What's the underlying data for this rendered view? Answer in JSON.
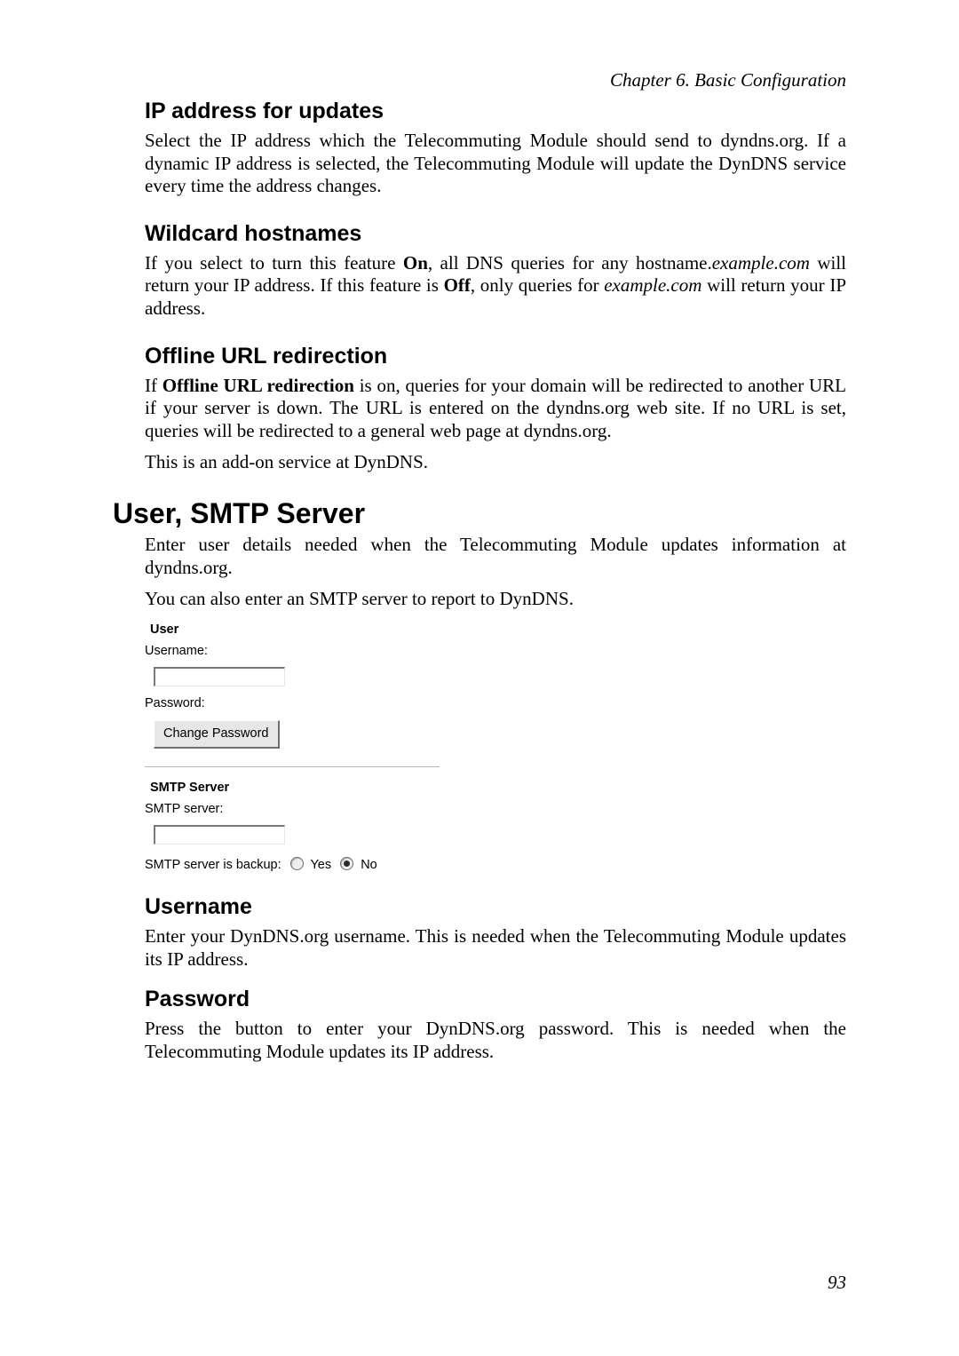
{
  "header": {
    "chapter": "Chapter 6. Basic Configuration"
  },
  "ip_updates": {
    "title": "IP address for updates",
    "text": "Select the IP address which the Telecommuting Module should send to dyndns.org. If a dynamic IP address is selected, the Telecommuting Module will update the DynDNS service every time the address changes."
  },
  "wildcard": {
    "title": "Wildcard hostnames",
    "t1": "If you select to turn this feature ",
    "on": "On",
    "t2": ", all DNS queries for any hostname.",
    "example1": "example.com",
    "t3": " will return your IP address. If this feature is ",
    "off": "Off",
    "t4": ", only queries for ",
    "example2": "example.com",
    "t5": " will return your IP address."
  },
  "offline": {
    "title": "Offline URL redirection",
    "p1a": "If ",
    "p1b": "Offline URL redirection",
    "p1c": " is on, queries for your domain will be redirected to another URL if your server is down. The URL is entered on the dyndns.org web site. If no URL is set, queries will be redirected to a general web page at dyndns.org.",
    "p2": "This is an add-on service at DynDNS."
  },
  "user_smtp": {
    "title": "User, SMTP Server",
    "p1": "Enter user details needed when the Telecommuting Module updates information at dyndns.org.",
    "p2": "You can also enter an SMTP server to report to DynDNS."
  },
  "ui": {
    "user_header": "User",
    "username_label": "Username:",
    "username_value": "",
    "password_label": "Password:",
    "change_password_btn": "Change Password",
    "smtp_header": "SMTP Server",
    "smtp_server_label": "SMTP server:",
    "smtp_server_value": "",
    "smtp_backup_label": "SMTP server is backup:",
    "yes": "Yes",
    "no": "No",
    "backup_selected": "No"
  },
  "username_section": {
    "title": "Username",
    "text": "Enter your DynDNS.org username. This is needed when the Telecommuting Module updates its IP address."
  },
  "password_section": {
    "title": "Password",
    "text": "Press the button to enter your DynDNS.org password. This is needed when the Telecommuting Module updates its IP address."
  },
  "page_number": "93"
}
